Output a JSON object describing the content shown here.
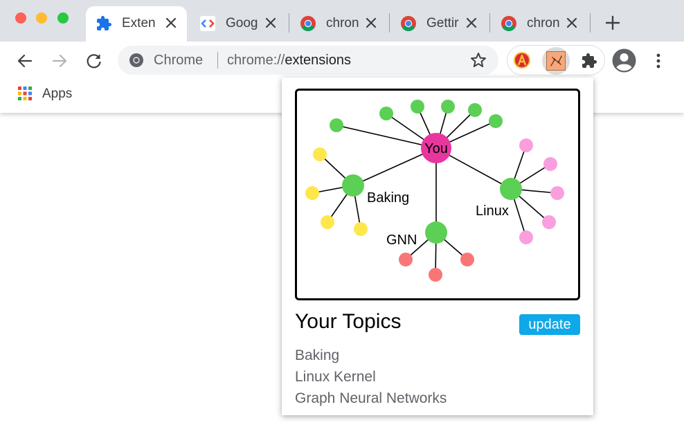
{
  "tabs": [
    {
      "title": "Exten",
      "icon": "puzzle-icon",
      "active": true
    },
    {
      "title": "Goog",
      "icon": "google-code-icon",
      "active": false
    },
    {
      "title": "chron",
      "icon": "chrome-icon",
      "active": false
    },
    {
      "title": "Gettir",
      "icon": "chrome-icon",
      "active": false
    },
    {
      "title": "chron",
      "icon": "chrome-icon",
      "active": false
    }
  ],
  "omnibox": {
    "host": "Chrome",
    "url_prefix": "chrome://",
    "url_path": "extensions"
  },
  "bookmarks": {
    "apps_label": "Apps"
  },
  "popup": {
    "graph": {
      "center_label": "You",
      "baking_label": "Baking",
      "linux_label": "Linux",
      "gnn_label": "GNN",
      "colors": {
        "center": "#e9369f",
        "hub": "#5ccf55",
        "baking_leaf": "#fde74c",
        "linux_leaf": "#f99fdd",
        "gnn_leaf": "#fa7676"
      }
    },
    "title": "Your Topics",
    "update_label": "update",
    "topics": [
      "Baking",
      "Linux Kernel",
      "Graph Neural Networks"
    ]
  },
  "colors": {
    "accent": "#0fa8e8",
    "tabstrip": "#dee1e6"
  }
}
